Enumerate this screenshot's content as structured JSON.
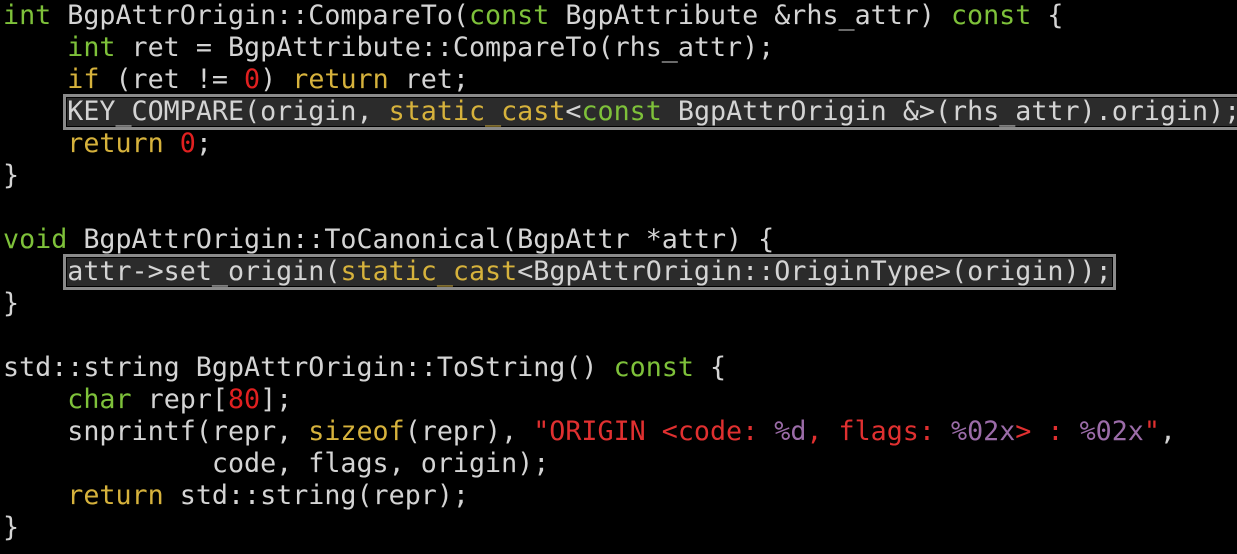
{
  "editor": {
    "lines": [
      {
        "tokens": [
          {
            "t": "int",
            "c": "type"
          },
          {
            "t": " BgpAttrOrigin::CompareTo(",
            "c": "plain"
          },
          {
            "t": "const",
            "c": "type"
          },
          {
            "t": " BgpAttribute &rhs_attr) ",
            "c": "plain"
          },
          {
            "t": "const",
            "c": "type"
          },
          {
            "t": " {",
            "c": "plain"
          }
        ]
      },
      {
        "tokens": [
          {
            "t": "    ",
            "c": "plain"
          },
          {
            "t": "int",
            "c": "type"
          },
          {
            "t": " ret = BgpAttribute::CompareTo(rhs_attr);",
            "c": "plain"
          }
        ]
      },
      {
        "tokens": [
          {
            "t": "    ",
            "c": "plain"
          },
          {
            "t": "if",
            "c": "kw"
          },
          {
            "t": " (ret != ",
            "c": "plain"
          },
          {
            "t": "0",
            "c": "num"
          },
          {
            "t": ") ",
            "c": "plain"
          },
          {
            "t": "return",
            "c": "kw"
          },
          {
            "t": " ret;",
            "c": "plain"
          }
        ]
      },
      {
        "hl": true,
        "indent": "    ",
        "tokens": [
          {
            "t": "KEY_COMPARE(origin, ",
            "c": "plain"
          },
          {
            "t": "static_cast",
            "c": "kw"
          },
          {
            "t": "<",
            "c": "plain"
          },
          {
            "t": "const",
            "c": "type"
          },
          {
            "t": " BgpAttrOrigin &>(rhs_attr).origin);",
            "c": "plain"
          }
        ]
      },
      {
        "tokens": [
          {
            "t": "    ",
            "c": "plain"
          },
          {
            "t": "return",
            "c": "kw"
          },
          {
            "t": " ",
            "c": "plain"
          },
          {
            "t": "0",
            "c": "num"
          },
          {
            "t": ";",
            "c": "plain"
          }
        ]
      },
      {
        "tokens": [
          {
            "t": "}",
            "c": "plain"
          }
        ]
      },
      {
        "tokens": [
          {
            "t": "",
            "c": "plain"
          }
        ]
      },
      {
        "tokens": [
          {
            "t": "void",
            "c": "type"
          },
          {
            "t": " BgpAttrOrigin::ToCanonical(BgpAttr *attr) {",
            "c": "plain"
          }
        ]
      },
      {
        "hl": true,
        "indent": "    ",
        "tokens": [
          {
            "t": "attr->set_origin(",
            "c": "plain"
          },
          {
            "t": "static_cast",
            "c": "kw"
          },
          {
            "t": "<BgpAttrOrigin::OriginType>(origin));",
            "c": "plain"
          }
        ]
      },
      {
        "tokens": [
          {
            "t": "}",
            "c": "plain"
          }
        ]
      },
      {
        "tokens": [
          {
            "t": "",
            "c": "plain"
          }
        ]
      },
      {
        "tokens": [
          {
            "t": "std::string BgpAttrOrigin::ToString() ",
            "c": "plain"
          },
          {
            "t": "const",
            "c": "type"
          },
          {
            "t": " {",
            "c": "plain"
          }
        ]
      },
      {
        "tokens": [
          {
            "t": "    ",
            "c": "plain"
          },
          {
            "t": "char",
            "c": "type"
          },
          {
            "t": " repr[",
            "c": "plain"
          },
          {
            "t": "80",
            "c": "num"
          },
          {
            "t": "];",
            "c": "plain"
          }
        ]
      },
      {
        "tokens": [
          {
            "t": "    snprintf(repr, ",
            "c": "plain"
          },
          {
            "t": "sizeof",
            "c": "kw"
          },
          {
            "t": "(repr), ",
            "c": "plain"
          },
          {
            "t": "\"ORIGIN <code: ",
            "c": "str"
          },
          {
            "t": "%d",
            "c": "fmt"
          },
          {
            "t": ", flags: ",
            "c": "str"
          },
          {
            "t": "%02x",
            "c": "fmt"
          },
          {
            "t": "> : ",
            "c": "str"
          },
          {
            "t": "%02x",
            "c": "fmt"
          },
          {
            "t": "\"",
            "c": "str"
          },
          {
            "t": ",",
            "c": "plain"
          }
        ]
      },
      {
        "tokens": [
          {
            "t": "             code, flags, origin);",
            "c": "plain"
          }
        ]
      },
      {
        "tokens": [
          {
            "t": "    ",
            "c": "plain"
          },
          {
            "t": "return",
            "c": "kw"
          },
          {
            "t": " std::string(repr);",
            "c": "plain"
          }
        ]
      },
      {
        "tokens": [
          {
            "t": "}",
            "c": "plain"
          }
        ]
      }
    ]
  }
}
